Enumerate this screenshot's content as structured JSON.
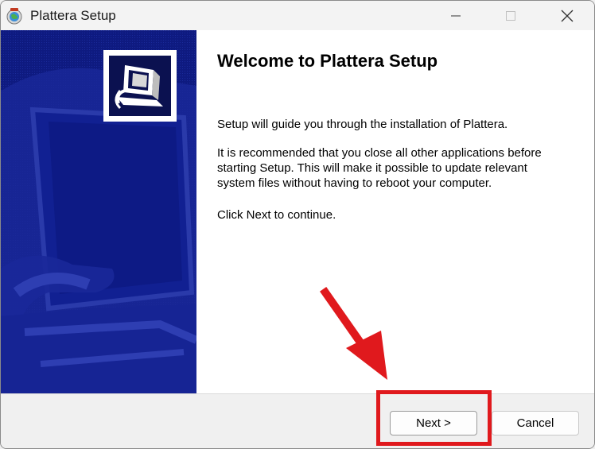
{
  "window": {
    "title": "Plattera Setup",
    "icon": "installer-globe-icon"
  },
  "titlebar": {
    "minimize_icon": "minimize-icon",
    "maximize_icon": "maximize-icon",
    "close_icon": "close-icon"
  },
  "main": {
    "heading": "Welcome to Plattera Setup",
    "paragraph_1": "Setup will guide you through the installation of Plattera.",
    "paragraph_2_lines": [
      "It is recommended that you close all other applications before",
      "starting Setup. This will make it possible to update relevant",
      "system files without having to reboot your computer."
    ],
    "paragraph_3": "Click Next to continue.",
    "logo_icon": "computer-install-icon"
  },
  "footer": {
    "next_label": "Next >",
    "cancel_label": "Cancel"
  },
  "annotation": {
    "color": "#e0191d",
    "arrow_icon": "red-arrow-icon"
  }
}
